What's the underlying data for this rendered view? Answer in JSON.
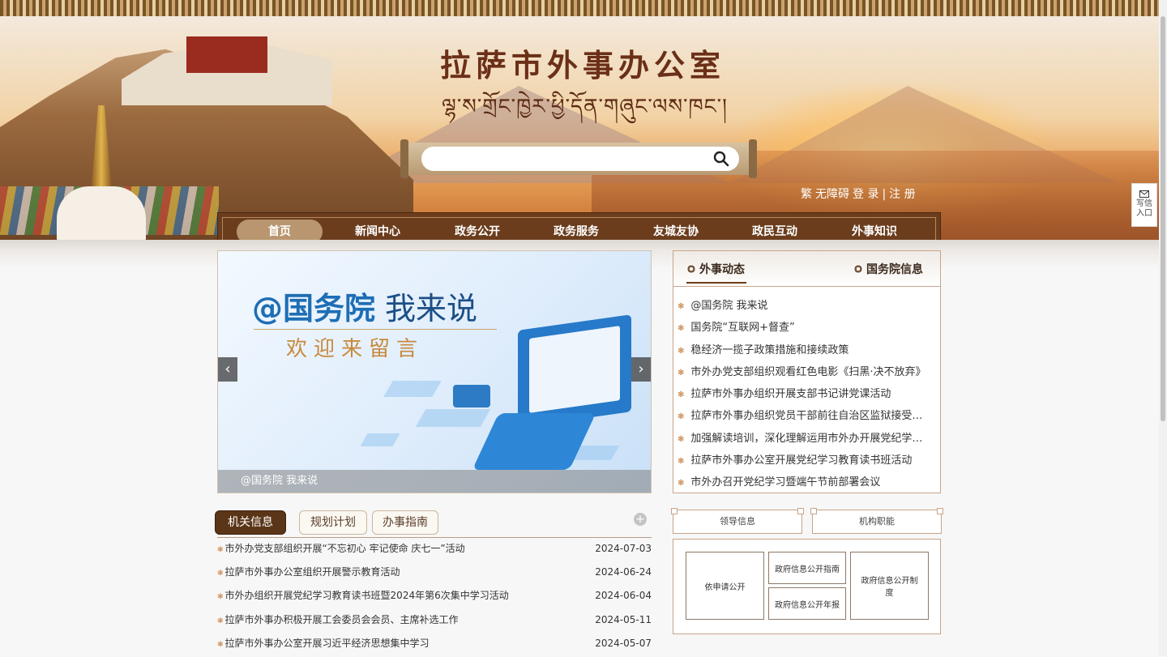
{
  "header": {
    "title_cn": "拉萨市外事办公室",
    "title_tib": "ལྷ་ས་གྲོང་ཁྱེར་ཕྱི་དོན་གཞུང་ལས་ཁང་།",
    "search_placeholder": "",
    "top_links": [
      "繁",
      "无障碍",
      "登 录",
      "|",
      "注 册"
    ]
  },
  "side_float": {
    "label_1": "写信",
    "label_2": "入口"
  },
  "nav": {
    "items": [
      "首页",
      "新闻中心",
      "政务公开",
      "政务服务",
      "友城友协",
      "政民互动",
      "外事知识"
    ],
    "active_index": 0
  },
  "banner": {
    "title": "@国务院",
    "title_sub": "我来说",
    "slogan": "欢迎来留言",
    "caption": "@国务院 我来说",
    "prev_label": "‹",
    "next_label": "›"
  },
  "news_panel": {
    "tabs": [
      "外事动态",
      "国务院信息"
    ],
    "active_tab": 0,
    "items": [
      "@国务院 我来说",
      "国务院“互联网+督查”",
      "稳经济一揽子政策措施和接续政策",
      "市外办党支部组织观看红色电影《扫黑·决不放弃》",
      "拉萨市外事办组织开展支部书记讲党课活动",
      "拉萨市外事办组织党员干部前往自治区监狱接受警示教育",
      "加强解读培训，深化理解运用市外办开展党纪学习教育",
      "拉萨市外事办公室开展党纪学习教育读书班活动",
      "市外办召开党纪学习暨端午节前部署会议"
    ]
  },
  "info_panel": {
    "tabs": [
      "机关信息",
      "规划计划",
      "办事指南"
    ],
    "active_tab": 0,
    "more_label": "+",
    "items": [
      {
        "title": "市外办党支部组织开展“不忘初心 牢记使命 庆七一”活动",
        "date": "2024-07-03"
      },
      {
        "title": "拉萨市外事办公室组织开展警示教育活动",
        "date": "2024-06-24"
      },
      {
        "title": "市外办组织开展党纪学习教育读书班暨2024年第6次集中学习活动",
        "date": "2024-06-04"
      },
      {
        "title": "拉萨市外事办积极开展工会委员会会员、主席补选工作",
        "date": "2024-05-11"
      },
      {
        "title": "拉萨市外事办公室开展习近平经济思想集中学习",
        "date": "2024-05-07"
      }
    ]
  },
  "quick_links": {
    "leader": "领导信息",
    "org": "机构职能",
    "apply_open": "依申请公开",
    "guide": "政府信息公开指南",
    "annual_report": "政府信息公开年报",
    "system": "政府信息公开制度"
  }
}
